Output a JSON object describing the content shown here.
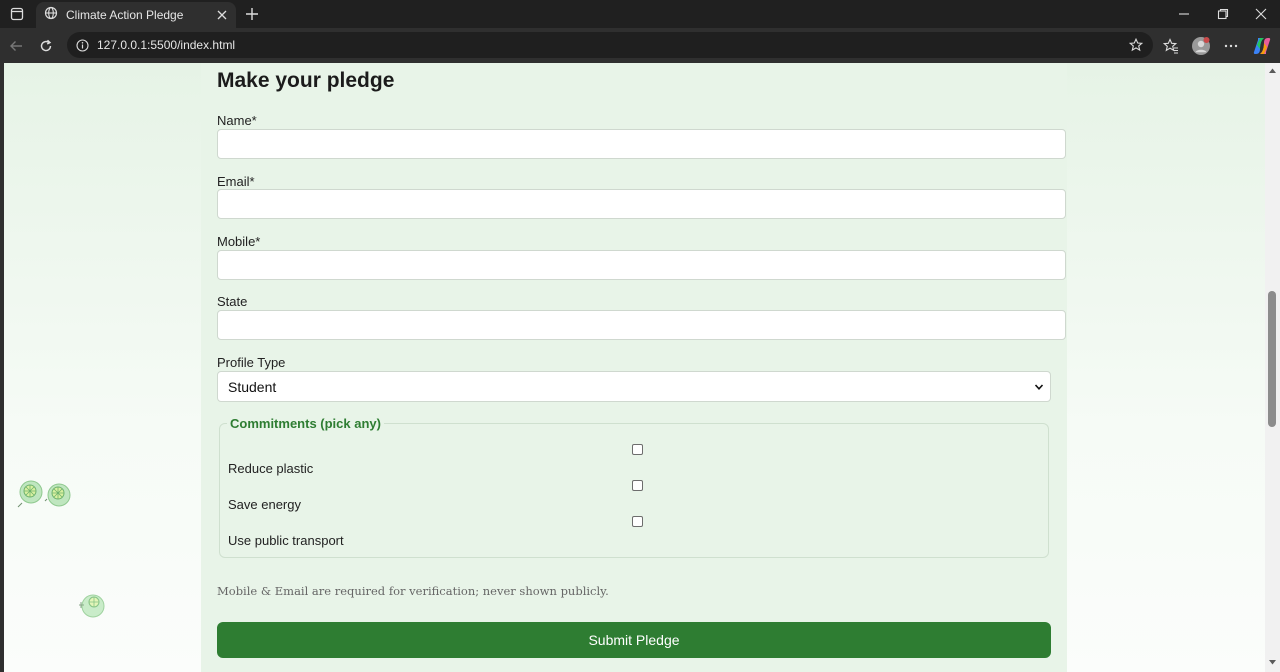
{
  "browser": {
    "tab_title": "Climate Action Pledge",
    "url": "127.0.0.1:5500/index.html"
  },
  "form": {
    "heading": "Make your pledge",
    "fields": [
      {
        "label": "Name*",
        "value": ""
      },
      {
        "label": "Email*",
        "value": ""
      },
      {
        "label": "Mobile*",
        "value": ""
      },
      {
        "label": "State",
        "value": ""
      }
    ],
    "profile_type": {
      "label": "Profile Type",
      "selected": "Student"
    },
    "commitments": {
      "legend": "Commitments (pick any)",
      "items": [
        {
          "label": "Reduce plastic",
          "checked": false
        },
        {
          "label": "Save energy",
          "checked": false
        },
        {
          "label": "Use public transport",
          "checked": false
        }
      ]
    },
    "note": "Mobile & Email are required for verification; never shown publicly.",
    "submit_label": "Submit Pledge"
  },
  "colors": {
    "accent": "#2e7d32",
    "page_background": "#e8f4e8"
  },
  "icons": [
    "tab-actions-icon",
    "globe-icon",
    "close-icon",
    "plus-icon",
    "minimize-icon",
    "restore-icon",
    "back-icon",
    "reload-icon",
    "info-icon",
    "star-icon",
    "favorites-icon",
    "profile-icon",
    "more-icon",
    "copilot-icon",
    "chevron-down-icon",
    "leaf-icon"
  ]
}
